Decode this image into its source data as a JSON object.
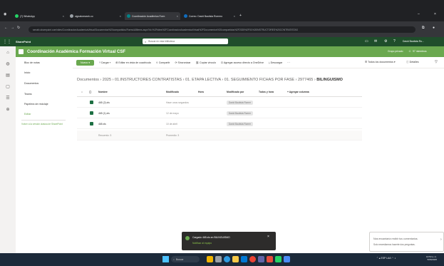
{
  "browser": {
    "tabs": [
      {
        "label": "(7) WhatsApp",
        "active": false,
        "color": "#25d366"
      },
      {
        "label": "signaturework.co",
        "active": false,
        "color": "#9aa0a6"
      },
      {
        "label": "Coordinación Académica Form",
        "active": true,
        "color": "#038387"
      },
      {
        "label": "Correo: David Bautista Romero",
        "active": false,
        "color": "#0f6cbd"
      }
    ],
    "url": "senafc.sharepoint.com/sites/CoordinacionAcademicaVirtual/Documentos%20compartidos/Forms/AllItems.aspx?id=%2Fsites%2FCoordinacionAcademicaVirtual%2FDocumentos%20compartidos%2F2025%2F01%20INSTRUCTORES%20CONTRATISTAS"
  },
  "suite": {
    "app_name": "SharePoint",
    "search_placeholder": "Buscar en esta biblioteca",
    "user": "David Bautista Ro..."
  },
  "site": {
    "title": "Coordinación Académica Formación Virtual CSF",
    "private_group": "Grupo privado",
    "members": "97 miembros"
  },
  "leftnav": {
    "items": [
      "Bloc de notas",
      "Inicio",
      "Documentos",
      "Teams",
      "Papelera de reciclaje",
      "Editar"
    ],
    "return_link": "Volver a la versión clásica de SharePoint"
  },
  "commands": {
    "new": "Nuevo",
    "upload": "Cargar",
    "edit_grid": "Editar en vista de cuadrícula",
    "share": "Compartir",
    "sync": "Sincronizar",
    "copy_link": "Copiar vínculo",
    "add_shortcut": "Agregar acceso directo a OneDrive",
    "download": "Descargar",
    "more": "···",
    "all_docs": "Todos los documentos",
    "details": "Detalles"
  },
  "breadcrumb": {
    "items": [
      "Documentos",
      "2025",
      "01.INSTRUCTORES CONTRATISTAS",
      "01. ETAPA LECTIVA",
      "01. SEGUIMIENTO FICHAS POR FASE",
      "2977465"
    ],
    "current": "BILINGUISMO"
  },
  "list": {
    "columns": [
      "Nombre",
      "Modificado",
      "Hora",
      "Modificado por",
      "Todos y hora",
      "+ Agregar columna"
    ],
    "rows": [
      {
        "name": "465 (2).xls",
        "modified": "Hace unos segundos",
        "by": "David Bautista Romer"
      },
      {
        "name": "465 (1).xls",
        "modified": "12 de mayo",
        "by": "David Bautista Romer"
      },
      {
        "name": "465.xls",
        "modified": "10 de abril",
        "by": "David Bautista Romer"
      }
    ],
    "footer_left": "Recuento: 3",
    "footer_right": "Promedio: 3"
  },
  "toast": {
    "title": "Cargado 465.xls en BILINGUISMO",
    "subtitle": "Notificar al equipo"
  },
  "feedback": {
    "line1": "Nos encantaría recibir tus comentarios.",
    "line2": "Solo necesitamos hacerte dos preguntas."
  },
  "taskbar": {
    "search": "Buscar",
    "time": "10:53 a. m.",
    "date": "5/06/2025",
    "lang": "ESP LAA"
  },
  "colors": {
    "brand_dark": "#1f4d2b",
    "brand": "#6aa84f",
    "browser_bg": "#202124"
  }
}
